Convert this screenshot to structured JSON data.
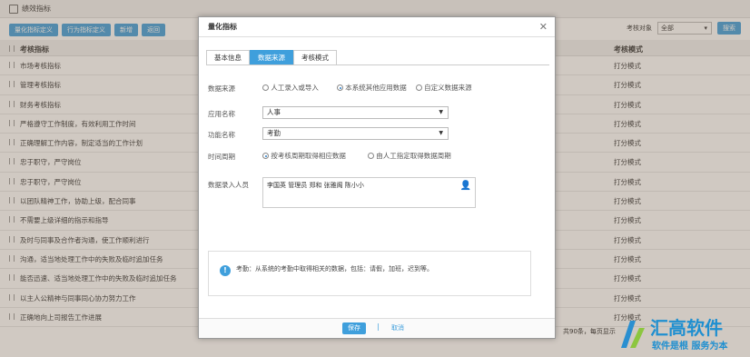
{
  "window": {
    "title": "绩效指标"
  },
  "toolbar": {
    "buttons": [
      "量化指标定义",
      "行为指标定义",
      "新增",
      "返回"
    ],
    "target_label": "考核对象",
    "target_value": "全部",
    "search_label": "搜索"
  },
  "grid": {
    "headers": {
      "name": "考核指标",
      "mode": "考核模式"
    },
    "rows": [
      {
        "name": "市场考核指标",
        "mode": "打分模式"
      },
      {
        "name": "管理考核指标",
        "mode": "打分模式"
      },
      {
        "name": "财务考核指标",
        "mode": "打分模式"
      },
      {
        "name": "严格遵守工作制度，有效利用工作时间",
        "mode": "打分模式"
      },
      {
        "name": "正确理解工作内容，制定适当的工作计划",
        "mode": "打分模式"
      },
      {
        "name": "忠于职守，严守岗位",
        "mode": "打分模式"
      },
      {
        "name": "忠于职守，严守岗位",
        "mode": "打分模式"
      },
      {
        "name": "以团队精神工作，协助上级，配合同事",
        "mode": "打分模式"
      },
      {
        "name": "不需要上级详细的指示和指导",
        "mode": "打分模式"
      },
      {
        "name": "及时与同事及合作者沟通，使工作顺利进行",
        "mode": "打分模式"
      },
      {
        "name": "沟通，适当地处理工作中的失败及临时追加任务",
        "mode": "打分模式"
      },
      {
        "name": "能否迅速、适当地处理工作中的失败及临时追加任务",
        "mode": "打分模式"
      },
      {
        "name": "以主人公精神与同事同心协力努力工作",
        "mode": "打分模式"
      },
      {
        "name": "正确地向上司报告工作进展",
        "mode": "打分模式"
      }
    ],
    "footer": "共90条，每页显示"
  },
  "modal": {
    "title": "量化指标",
    "tabs": [
      "基本信息",
      "数据来源",
      "考核模式"
    ],
    "source": {
      "label": "数据来源",
      "options": [
        "人工录入或导入",
        "本系统其他应用数据",
        "自定义数据来源"
      ],
      "selected": 1
    },
    "app": {
      "label": "应用名称",
      "value": "人事"
    },
    "func": {
      "label": "功能名称",
      "value": "考勤"
    },
    "period": {
      "label": "时间周期",
      "options": [
        "按考核周期取得相应数据",
        "由人工指定取得数据周期"
      ],
      "selected": 0
    },
    "entry": {
      "label": "数据录入人员",
      "value": "李国英  管理员  郑和  张雅阁  陈小小"
    },
    "info": "考勤：从系统的考勤中取得相关的数据，包括：请假，加班，迟到等。",
    "save": "保存",
    "cancel": "取消"
  },
  "watermark": {
    "name": "汇高软件",
    "slogan": "软件是根  服务为本"
  }
}
